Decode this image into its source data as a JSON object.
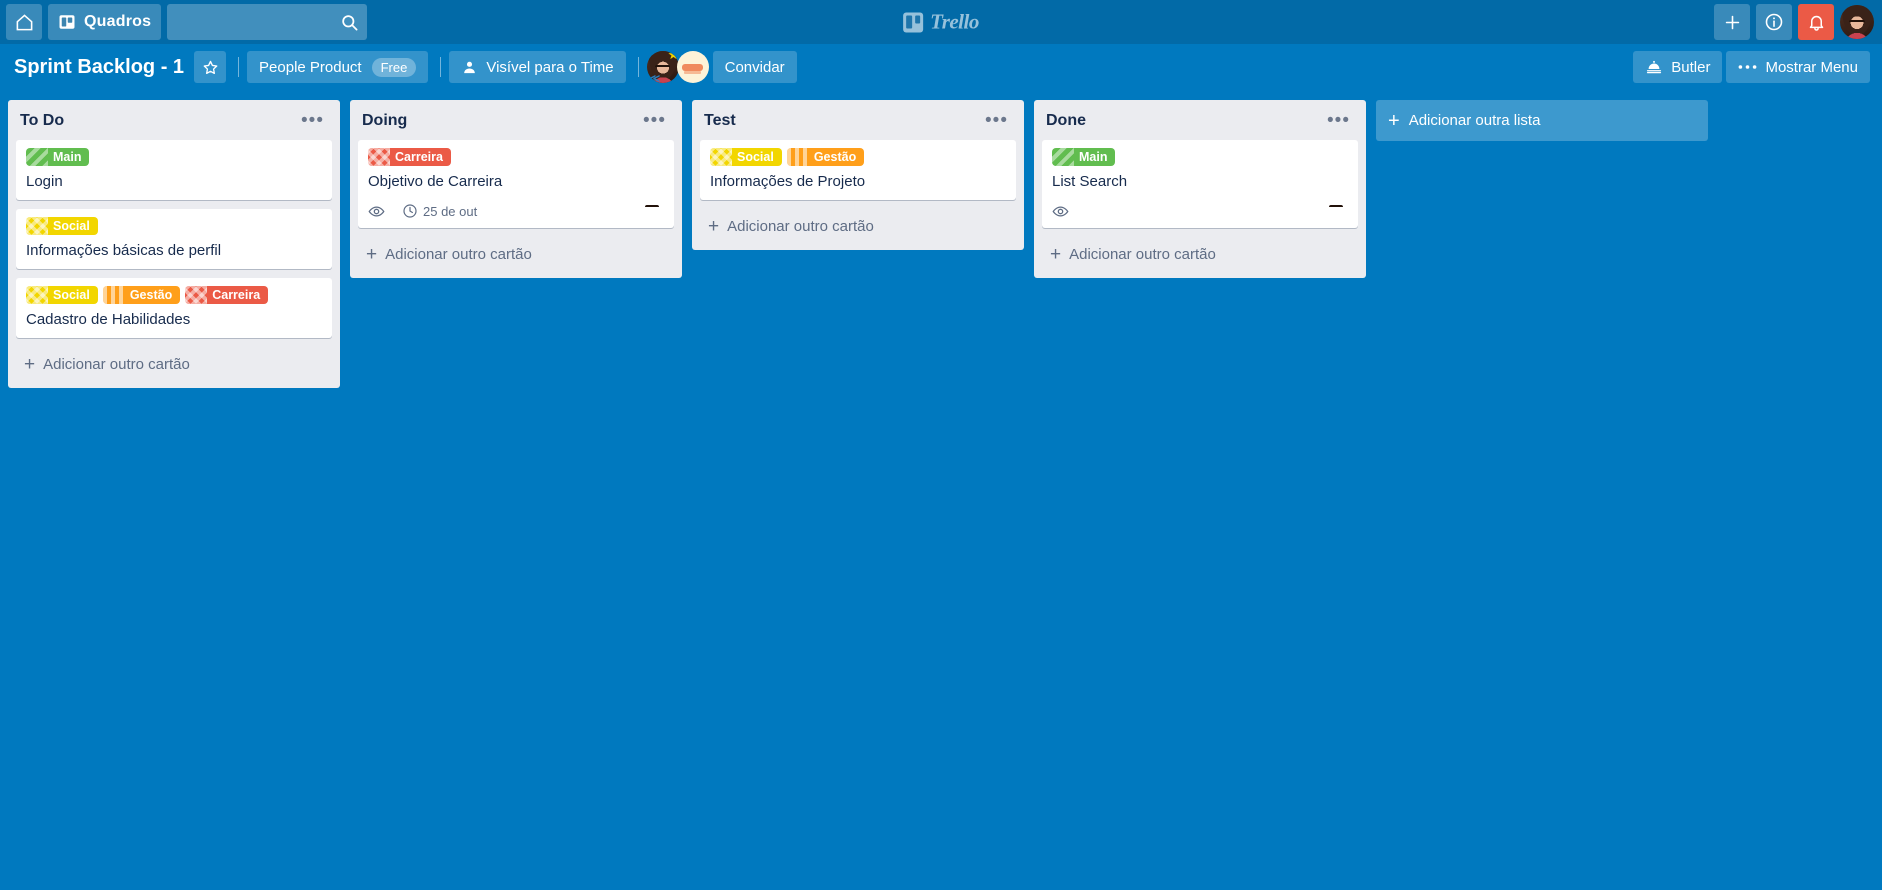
{
  "header": {
    "home_tooltip": "Início",
    "boards_label": "Quadros",
    "search": {
      "value": "",
      "placeholder": ""
    },
    "logo_text": "Trello",
    "add_label": "+",
    "info_label": "i",
    "notifications_label": "Notificações",
    "icons": {
      "home": "home-icon",
      "boards": "board-icon",
      "search": "search-icon",
      "add": "plus-icon",
      "info": "info-icon",
      "bell": "bell-icon",
      "avatar": "user-avatar"
    },
    "colors": {
      "header_bg": "#026aa7",
      "notification_bg": "#eb5a46"
    }
  },
  "board_bar": {
    "title": "Sprint Backlog - 1",
    "star_icon": "star-icon",
    "team_name": "People Product",
    "plan_badge": "Free",
    "visibility_label": "Visível para o Time",
    "visibility_icon": "team-icon",
    "invite_label": "Convidar",
    "butler_label": "Butler",
    "butler_icon": "butler-dome-icon",
    "show_menu_label": "Mostrar Menu",
    "show_menu_icon": "ellipsis-icon",
    "members": [
      {
        "name": "member-admin",
        "style": "woman",
        "star": "★",
        "chevron": "≪"
      },
      {
        "name": "member-second",
        "style": "cream",
        "star": "",
        "chevron": ""
      }
    ],
    "colors": {
      "board_bg": "#0079bf"
    }
  },
  "board": {
    "add_list_label": "Adicionar outra lista",
    "add_card_label": "Adicionar outro cartão",
    "list_menu_glyph": "•••",
    "lists": [
      {
        "name": "to-do",
        "title": "To Do",
        "cards": [
          {
            "title": "Login",
            "labels": [
              {
                "text": "Main",
                "color": "green"
              }
            ],
            "badges": [],
            "avatar": null
          },
          {
            "title": "Informações básicas de perfil",
            "labels": [
              {
                "text": "Social",
                "color": "yellow"
              }
            ],
            "badges": [],
            "avatar": null
          },
          {
            "title": "Cadastro de Habilidades",
            "labels": [
              {
                "text": "Social",
                "color": "yellow"
              },
              {
                "text": "Gestão",
                "color": "orange"
              },
              {
                "text": "Carreira",
                "color": "red"
              }
            ],
            "badges": [],
            "avatar": null
          }
        ]
      },
      {
        "name": "doing",
        "title": "Doing",
        "cards": [
          {
            "title": "Objetivo de Carreira",
            "labels": [
              {
                "text": "Carreira",
                "color": "red"
              }
            ],
            "badges": [
              {
                "icon": "eye-icon",
                "text": ""
              },
              {
                "icon": "clock-icon",
                "text": "25 de out"
              }
            ],
            "avatar": "woman"
          }
        ]
      },
      {
        "name": "test",
        "title": "Test",
        "cards": [
          {
            "title": "Informações de Projeto",
            "labels": [
              {
                "text": "Social",
                "color": "yellow"
              },
              {
                "text": "Gestão",
                "color": "orange"
              }
            ],
            "badges": [],
            "avatar": "cream"
          }
        ]
      },
      {
        "name": "done",
        "title": "Done",
        "cards": [
          {
            "title": "List Search",
            "labels": [
              {
                "text": "Main",
                "color": "green"
              }
            ],
            "badges": [
              {
                "icon": "eye-icon",
                "text": ""
              }
            ],
            "avatar": "woman"
          }
        ]
      }
    ]
  },
  "label_colors": {
    "green": "#61bd4f",
    "yellow": "#f2d600",
    "orange": "#ff9f1a",
    "red": "#eb5a46"
  }
}
